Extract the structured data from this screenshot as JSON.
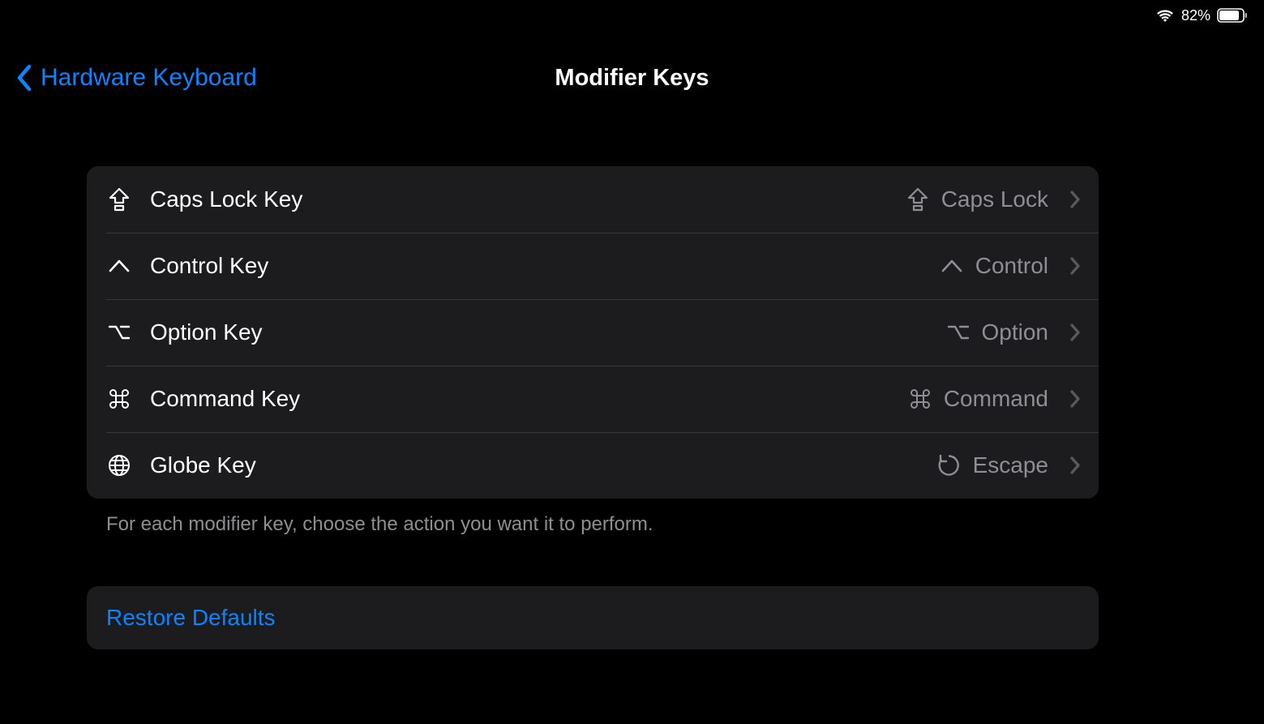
{
  "status": {
    "battery_pct": "82%"
  },
  "nav": {
    "back_label": "Hardware Keyboard",
    "title": "Modifier Keys"
  },
  "rows": [
    {
      "icon": "capslock",
      "label": "Caps Lock Key",
      "value_icon": "capslock",
      "value": "Caps Lock"
    },
    {
      "icon": "control",
      "label": "Control Key",
      "value_icon": "control",
      "value": "Control"
    },
    {
      "icon": "option",
      "label": "Option Key",
      "value_icon": "option",
      "value": "Option"
    },
    {
      "icon": "command",
      "label": "Command Key",
      "value_icon": "command",
      "value": "Command"
    },
    {
      "icon": "globe",
      "label": "Globe Key",
      "value_icon": "escape",
      "value": "Escape"
    }
  ],
  "footer": "For each modifier key, choose the action you want it to perform.",
  "restore": "Restore Defaults"
}
